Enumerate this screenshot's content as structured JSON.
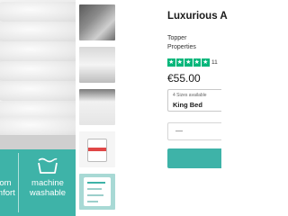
{
  "product": {
    "title": "Luxurious A",
    "vendor_line1": "Topper",
    "vendor_line2": "Properties",
    "rating_count": "11",
    "price": "€55.00"
  },
  "size_selector": {
    "label": "4 Sizes available",
    "value": "King Bed"
  },
  "quantity": {
    "minus_label": "—"
  },
  "feature_banner": {
    "left_text_1": "om",
    "left_text_2": "mfort",
    "right_text_1": "machine",
    "right_text_2": "washable",
    "background_color": "#3eb3a8"
  },
  "rating_stars": {
    "color": "#00b67a",
    "stars_filled": 5
  },
  "colors": {
    "accent": "#3eb3a8"
  }
}
